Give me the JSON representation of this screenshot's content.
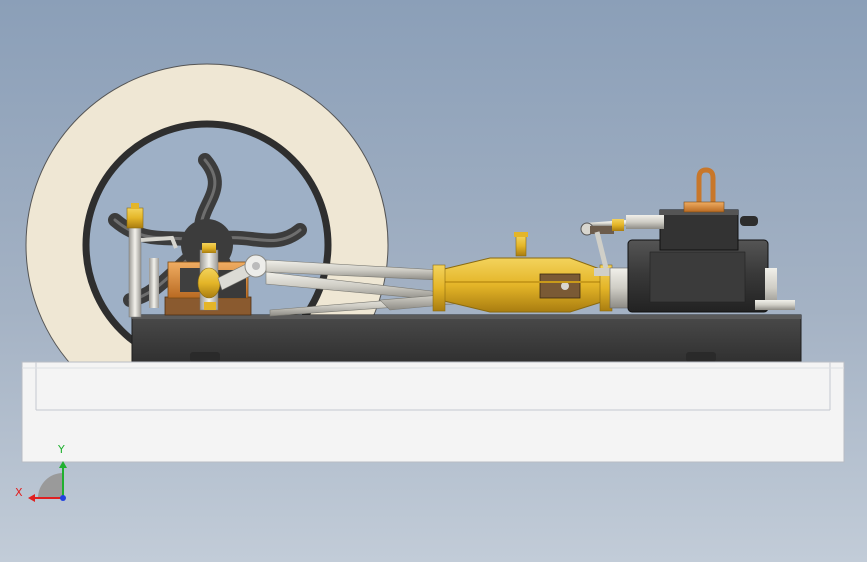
{
  "viewport": {
    "background_top": "#8b9fb8",
    "background_bottom": "#c2ccd8"
  },
  "model": {
    "parts": [
      "flywheel",
      "crankshaft-bearing",
      "crank",
      "connecting-rod",
      "crosshead-guide",
      "valve-linkage",
      "cylinder",
      "chimney-pipe",
      "base-plate",
      "display-board"
    ],
    "colors": {
      "flywheel_rim": "#efe7d4",
      "flywheel_spokes": "#3d3d3d",
      "brass": "#e4b528",
      "copper": "#d88a3a",
      "steel": "#d7d6d0",
      "base_plate": "#3f3f3f",
      "board": "#f3f3f3"
    }
  },
  "triad": {
    "x_label": "X",
    "y_label": "Y",
    "x_color": "#e02020",
    "y_color": "#20b030",
    "z_color": "#2040e0"
  }
}
